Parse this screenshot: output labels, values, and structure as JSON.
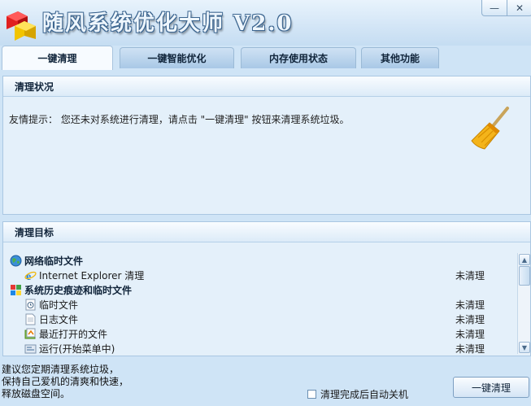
{
  "app": {
    "title": "随风系统优化大师 V2.0"
  },
  "window_buttons": {
    "minimize": "—",
    "close": "✕"
  },
  "tabs": [
    {
      "label": "一键清理",
      "active": true
    },
    {
      "label": "一键智能优化",
      "active": false
    },
    {
      "label": "内存使用状态",
      "active": false
    },
    {
      "label": "其他功能",
      "active": false
    }
  ],
  "status_panel": {
    "title": "清理状况",
    "hint": "友情提示：  您还未对系统进行清理，请点击 \"一键清理\" 按钮来清理系统垃圾。"
  },
  "target_panel": {
    "title": "清理目标",
    "items": [
      {
        "type": "group",
        "icon": "globe-icon",
        "label": "网络临时文件",
        "status": ""
      },
      {
        "type": "item",
        "icon": "ie-icon",
        "label": "Internet Explorer 清理",
        "status": "未清理"
      },
      {
        "type": "group",
        "icon": "windows-icon",
        "label": "系统历史痕迹和临时文件",
        "status": ""
      },
      {
        "type": "item",
        "icon": "file-clock-icon",
        "label": "临时文件",
        "status": "未清理"
      },
      {
        "type": "item",
        "icon": "log-file-icon",
        "label": "日志文件",
        "status": "未清理"
      },
      {
        "type": "item",
        "icon": "recent-files-icon",
        "label": "最近打开的文件",
        "status": "未清理"
      },
      {
        "type": "item",
        "icon": "run-icon",
        "label": "运行(开始菜单中)",
        "status": "未清理"
      }
    ]
  },
  "advice": {
    "lines": [
      "建议您定期清理系统垃圾，",
      "保持自己爱机的清爽和快速，",
      "释放磁盘空间。"
    ]
  },
  "auto_shutdown": {
    "label": "清理完成后自动关机",
    "checked": false
  },
  "clean_button": {
    "label": "一键清理"
  }
}
